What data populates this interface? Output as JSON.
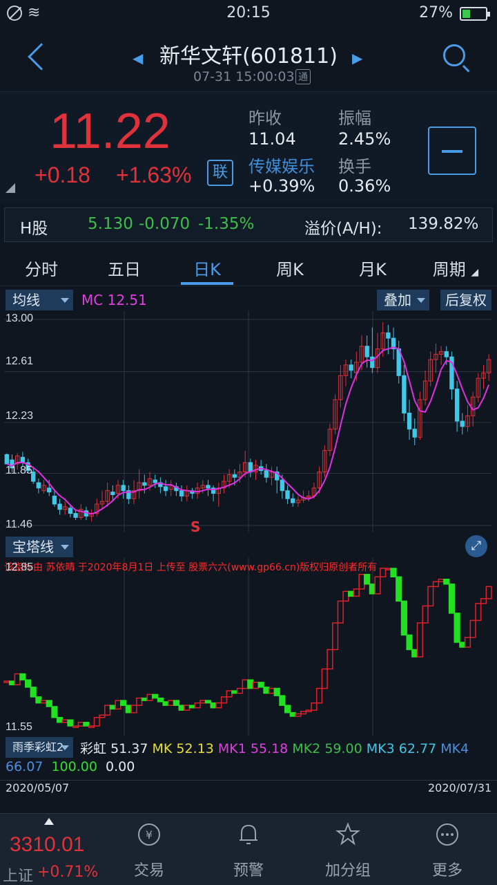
{
  "status_bar": {
    "time": "20:15",
    "battery_pct": "27%"
  },
  "header": {
    "stock_name": "新华文轩(601811)",
    "datetime": "07-31 15:00:03",
    "badge": "通"
  },
  "quote": {
    "price": "11.22",
    "change": "+0.18",
    "change_pct": "+1.63%",
    "lian_label": "联",
    "prev_close_label": "昨收",
    "prev_close": "11.04",
    "amplitude_label": "振幅",
    "amplitude": "2.45%",
    "sector": "传媒娱乐",
    "sector_change": "+0.39%",
    "turnover_label": "换手",
    "turnover": "0.36%"
  },
  "h_share": {
    "label": "H股",
    "price": "5.130",
    "change": "-0.070",
    "change_pct": "-1.35%",
    "premium_label": "溢价(A/H):",
    "premium": "139.82%"
  },
  "tabs": [
    "分时",
    "五日",
    "日K",
    "周K",
    "月K",
    "周期"
  ],
  "chart_controls": {
    "ma_button": "均线",
    "mc_label": "MC",
    "mc_value": "12.51",
    "overlay_button": "叠加",
    "adjust_button": "后复权",
    "tower_button": "宝塔线",
    "rainbow_button": "雨季彩虹2"
  },
  "main_chart": {
    "y_labels": [
      "13.00",
      "12.61",
      "12.23",
      "11.85",
      "11.46"
    ],
    "marker": "S"
  },
  "sub_chart": {
    "y_labels": [
      "12.85",
      "11.55"
    ],
    "watermark": "该指标由 苏依晴 于2020年8月1日 上传至 股票六六(www.gp66.cn)版权归原创者所有"
  },
  "indicators": {
    "caihong_label": "彩虹",
    "caihong": "51.37",
    "mk_label": "MK",
    "mk": "52.13",
    "mk1_label": "MK1",
    "mk1": "55.18",
    "mk2_label": "MK2",
    "mk2": "59.00",
    "mk3_label": "MK3",
    "mk3": "62.77",
    "mk4_label": "MK4",
    "mk4": "66.07",
    "v1": "100.00",
    "v2": "0.00"
  },
  "dates": {
    "start": "2020/05/07",
    "end": "2020/07/31"
  },
  "bottom_nav": {
    "index_value": "3310.01",
    "index_name": "上证",
    "index_change": "+0.71%",
    "items": [
      "交易",
      "预警",
      "加分组",
      "更多"
    ]
  },
  "chart_data": {
    "type": "candlestick",
    "x_range": [
      "2020/05/07",
      "2020/07/31"
    ],
    "y_range": [
      11.46,
      13.0
    ],
    "candles": [
      [
        11.99,
        11.92,
        11.95,
        12.0
      ],
      [
        11.95,
        11.89,
        11.86,
        11.99
      ],
      [
        11.92,
        11.98,
        11.88,
        12.0
      ],
      [
        11.97,
        11.93,
        11.9,
        12.01
      ],
      [
        11.93,
        11.87,
        11.85,
        11.96
      ],
      [
        11.86,
        11.79,
        11.77,
        11.9
      ],
      [
        11.78,
        11.74,
        11.7,
        11.81
      ],
      [
        11.72,
        11.76,
        11.7,
        11.8
      ],
      [
        11.74,
        11.71,
        11.68,
        11.8
      ],
      [
        11.68,
        11.62,
        11.6,
        11.72
      ],
      [
        11.62,
        11.58,
        11.54,
        11.66
      ],
      [
        11.58,
        11.6,
        11.54,
        11.64
      ],
      [
        11.59,
        11.55,
        11.52,
        11.62
      ],
      [
        11.55,
        11.52,
        11.5,
        11.58
      ],
      [
        11.52,
        11.58,
        11.5,
        11.62
      ],
      [
        11.57,
        11.53,
        11.5,
        11.6
      ],
      [
        11.53,
        11.55,
        11.49,
        11.58
      ],
      [
        11.55,
        11.62,
        11.53,
        11.66
      ],
      [
        11.62,
        11.64,
        11.58,
        11.72
      ],
      [
        11.64,
        11.72,
        11.6,
        11.78
      ],
      [
        11.71,
        11.69,
        11.64,
        11.76
      ],
      [
        11.7,
        11.76,
        11.66,
        11.8
      ],
      [
        11.76,
        11.72,
        11.66,
        11.8
      ],
      [
        11.72,
        11.66,
        11.62,
        11.76
      ],
      [
        11.66,
        11.72,
        11.62,
        11.8
      ],
      [
        11.72,
        11.78,
        11.66,
        11.88
      ],
      [
        11.78,
        11.76,
        11.7,
        11.84
      ],
      [
        11.76,
        11.81,
        11.72,
        11.86
      ],
      [
        11.8,
        11.78,
        11.74,
        11.84
      ],
      [
        11.78,
        11.75,
        11.7,
        11.82
      ],
      [
        11.75,
        11.72,
        11.68,
        11.8
      ],
      [
        11.73,
        11.76,
        11.68,
        11.8
      ],
      [
        11.75,
        11.72,
        11.68,
        11.78
      ],
      [
        11.72,
        11.68,
        11.64,
        11.76
      ],
      [
        11.68,
        11.72,
        11.64,
        11.76
      ],
      [
        11.72,
        11.7,
        11.66,
        11.74
      ],
      [
        11.7,
        11.74,
        11.66,
        11.78
      ],
      [
        11.74,
        11.76,
        11.7,
        11.8
      ],
      [
        11.76,
        11.74,
        11.68,
        11.8
      ],
      [
        11.74,
        11.7,
        11.64,
        11.76
      ],
      [
        11.7,
        11.74,
        11.6,
        11.78
      ],
      [
        11.74,
        11.79,
        11.7,
        11.84
      ],
      [
        11.79,
        11.84,
        11.74,
        11.88
      ],
      [
        11.84,
        11.82,
        11.76,
        11.88
      ],
      [
        11.82,
        11.86,
        11.78,
        11.92
      ],
      [
        11.86,
        11.93,
        11.82,
        12.02
      ],
      [
        11.93,
        11.86,
        11.82,
        11.96
      ],
      [
        11.86,
        11.91,
        11.8,
        11.95
      ],
      [
        11.9,
        11.87,
        11.84,
        11.95
      ],
      [
        11.87,
        11.82,
        11.78,
        11.92
      ],
      [
        11.82,
        11.86,
        11.76,
        11.9
      ],
      [
        11.86,
        11.8,
        11.7,
        11.9
      ],
      [
        11.8,
        11.72,
        11.66,
        11.84
      ],
      [
        11.72,
        11.66,
        11.62,
        11.76
      ],
      [
        11.66,
        11.63,
        11.6,
        11.7
      ],
      [
        11.63,
        11.65,
        11.6,
        11.68
      ],
      [
        11.65,
        11.67,
        11.63,
        11.72
      ],
      [
        11.67,
        11.68,
        11.64,
        11.72
      ],
      [
        11.68,
        11.74,
        11.66,
        11.78
      ],
      [
        11.74,
        11.86,
        11.7,
        11.9
      ],
      [
        11.86,
        12.02,
        11.82,
        12.06
      ],
      [
        12.02,
        12.18,
        11.98,
        12.22
      ],
      [
        12.18,
        12.4,
        12.14,
        12.44
      ],
      [
        12.4,
        12.58,
        12.34,
        12.66
      ],
      [
        12.58,
        12.66,
        12.5,
        12.7
      ],
      [
        12.66,
        12.62,
        12.56,
        12.7
      ],
      [
        12.6,
        12.68,
        12.54,
        12.76
      ],
      [
        12.68,
        12.8,
        12.62,
        12.88
      ],
      [
        12.8,
        12.72,
        12.64,
        12.88
      ],
      [
        12.72,
        12.64,
        12.6,
        12.94
      ],
      [
        12.64,
        12.78,
        12.6,
        12.9
      ],
      [
        12.78,
        12.9,
        12.72,
        12.98
      ],
      [
        12.9,
        12.86,
        12.74,
        12.96
      ],
      [
        12.86,
        12.78,
        12.7,
        12.94
      ],
      [
        12.78,
        12.58,
        12.52,
        12.84
      ],
      [
        12.58,
        12.3,
        12.24,
        12.66
      ],
      [
        12.3,
        12.18,
        12.1,
        12.4
      ],
      [
        12.18,
        12.12,
        12.06,
        12.26
      ],
      [
        12.12,
        12.4,
        12.1,
        12.46
      ],
      [
        12.4,
        12.54,
        12.36,
        12.62
      ],
      [
        12.54,
        12.7,
        12.5,
        12.76
      ],
      [
        12.7,
        12.74,
        12.6,
        12.82
      ],
      [
        12.74,
        12.76,
        12.66,
        12.8
      ],
      [
        12.76,
        12.72,
        12.66,
        12.8
      ],
      [
        12.72,
        12.48,
        12.4,
        12.76
      ],
      [
        12.48,
        12.24,
        12.16,
        12.54
      ],
      [
        12.24,
        12.2,
        12.14,
        12.3
      ],
      [
        12.2,
        12.28,
        12.16,
        12.36
      ],
      [
        12.28,
        12.42,
        12.2,
        12.46
      ],
      [
        12.42,
        12.56,
        12.38,
        12.6
      ],
      [
        12.56,
        12.6,
        12.48,
        12.66
      ],
      [
        12.6,
        12.7,
        12.54,
        12.74
      ]
    ]
  }
}
